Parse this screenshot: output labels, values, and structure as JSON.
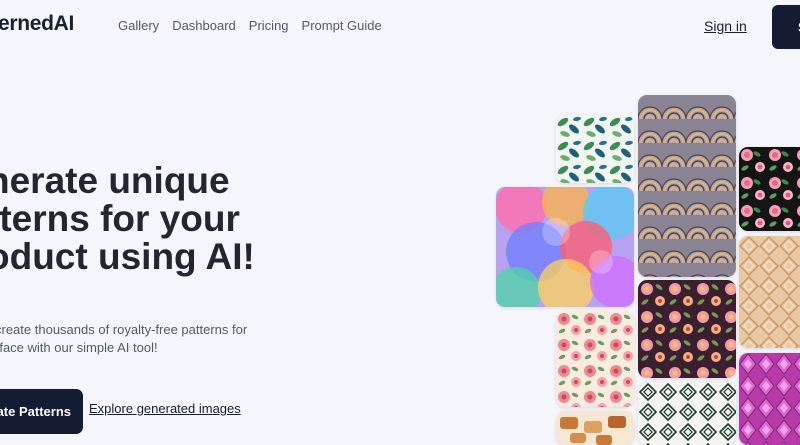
{
  "nav": {
    "logo": "ernedAI",
    "links": [
      "Gallery",
      "Dashboard",
      "Pricing",
      "Prompt Guide"
    ],
    "signin": "Sign in",
    "start_button": "S"
  },
  "hero": {
    "title": [
      "nerate unique",
      "tterns for your",
      "oduct using AI!"
    ],
    "subtitle": [
      "create thousands of royalty-free patterns for",
      "rface with our simple AI tool!"
    ],
    "cta_primary": "ate Patterns",
    "cta_secondary": "Explore generated images"
  },
  "colors": {
    "background": "#f4f6fb",
    "primary_button": "#141c33",
    "text_dark": "#23262f",
    "text_muted": "#555a66"
  },
  "gallery": {
    "tiles": [
      "leaves-pattern",
      "art-deco-fan-pattern",
      "rose-on-black-pattern",
      "rainbow-circles-pattern",
      "beige-geometric-pattern",
      "pink-floral-pattern",
      "purple-floral-pattern",
      "magenta-diamond-pattern",
      "diamond-outline-pattern",
      "baked-goods-pattern"
    ]
  }
}
